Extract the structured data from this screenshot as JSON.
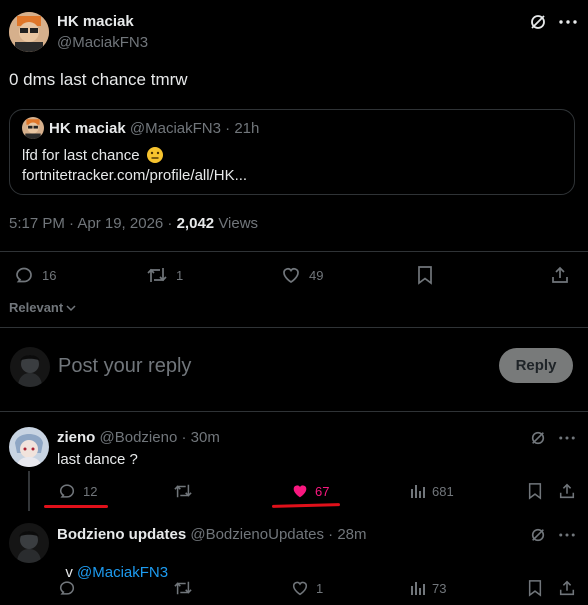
{
  "post": {
    "author_name": "HK maciak",
    "handle": "@MaciakFN3",
    "text": "0 dms last chance tmrw",
    "quote": {
      "author_name": "HK maciak",
      "handle": "@MaciakFN3",
      "time": "21h",
      "line1": "lfd for last chance",
      "line2": "fortnitetracker.com/profile/all/HK..."
    },
    "timestamp": "5:17 PM · Apr 19, 2026 · ",
    "views_count": "2,042",
    "views_label": "Views",
    "actions": {
      "replies": "16",
      "reposts": "1",
      "likes": "49"
    }
  },
  "sort_label": "Relevant",
  "reply_box": {
    "placeholder": "Post your reply",
    "button": "Reply"
  },
  "replies": [
    {
      "author_name": "zieno",
      "handle": "@Bodzieno",
      "time": "· 30m",
      "text": "last dance ?",
      "replies": "12",
      "likes": "67",
      "views": "681"
    },
    {
      "author_name": "Bodzieno updates",
      "handle": "@BodzienoUpdates",
      "time": "· 28m",
      "text_prefix": "v ",
      "mention": "@MaciakFN3",
      "likes": "1",
      "views": "73"
    }
  ],
  "colors": {
    "accent": "#1d9bf0",
    "like_active": "#f91880",
    "annotation": "#e0101a"
  }
}
